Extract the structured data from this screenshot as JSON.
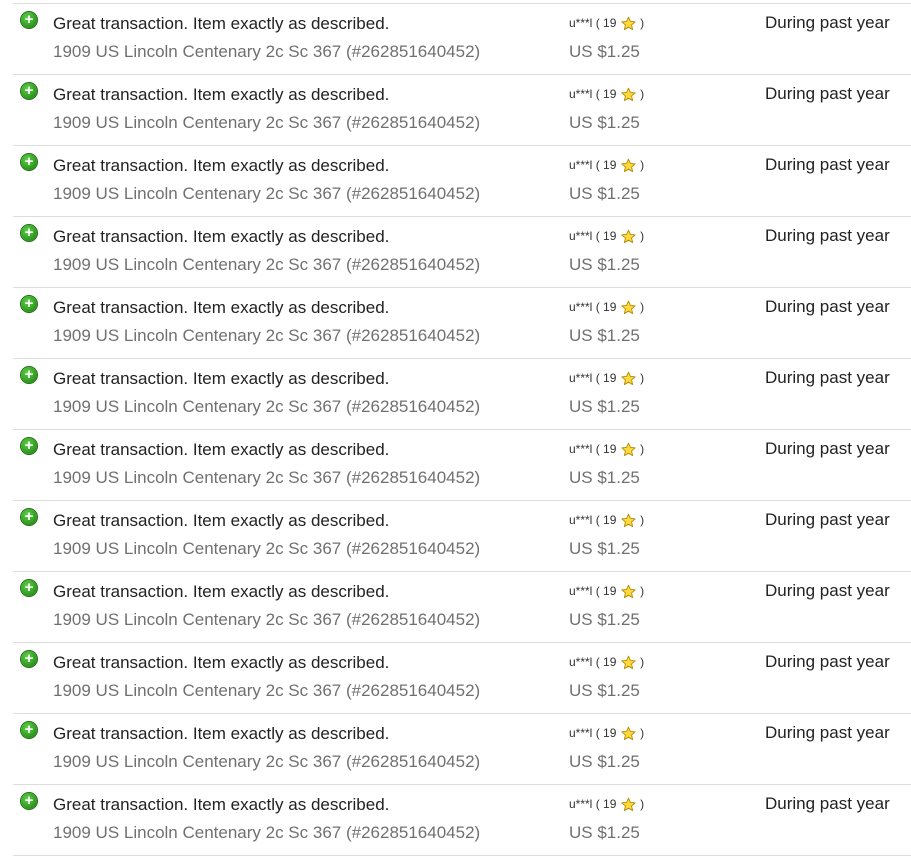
{
  "feedback": [
    {
      "comment": "Great transaction. Item exactly as described.",
      "item": "1909 US Lincoln Centenary 2c Sc 367 (#262851640452)",
      "user": "u***l",
      "score": "19",
      "price": "US $1.25",
      "period": "During past year",
      "icon": "plus-circle-icon",
      "star_icon": "star-icon"
    },
    {
      "comment": "Great transaction. Item exactly as described.",
      "item": "1909 US Lincoln Centenary 2c Sc 367 (#262851640452)",
      "user": "u***l",
      "score": "19",
      "price": "US $1.25",
      "period": "During past year",
      "icon": "plus-circle-icon",
      "star_icon": "star-icon"
    },
    {
      "comment": "Great transaction. Item exactly as described.",
      "item": "1909 US Lincoln Centenary 2c Sc 367 (#262851640452)",
      "user": "u***l",
      "score": "19",
      "price": "US $1.25",
      "period": "During past year",
      "icon": "plus-circle-icon",
      "star_icon": "star-icon"
    },
    {
      "comment": "Great transaction. Item exactly as described.",
      "item": "1909 US Lincoln Centenary 2c Sc 367 (#262851640452)",
      "user": "u***l",
      "score": "19",
      "price": "US $1.25",
      "period": "During past year",
      "icon": "plus-circle-icon",
      "star_icon": "star-icon"
    },
    {
      "comment": "Great transaction. Item exactly as described.",
      "item": "1909 US Lincoln Centenary 2c Sc 367 (#262851640452)",
      "user": "u***l",
      "score": "19",
      "price": "US $1.25",
      "period": "During past year",
      "icon": "plus-circle-icon",
      "star_icon": "star-icon"
    },
    {
      "comment": "Great transaction. Item exactly as described.",
      "item": "1909 US Lincoln Centenary 2c Sc 367 (#262851640452)",
      "user": "u***l",
      "score": "19",
      "price": "US $1.25",
      "period": "During past year",
      "icon": "plus-circle-icon",
      "star_icon": "star-icon"
    },
    {
      "comment": "Great transaction. Item exactly as described.",
      "item": "1909 US Lincoln Centenary 2c Sc 367 (#262851640452)",
      "user": "u***l",
      "score": "19",
      "price": "US $1.25",
      "period": "During past year",
      "icon": "plus-circle-icon",
      "star_icon": "star-icon"
    },
    {
      "comment": "Great transaction. Item exactly as described.",
      "item": "1909 US Lincoln Centenary 2c Sc 367 (#262851640452)",
      "user": "u***l",
      "score": "19",
      "price": "US $1.25",
      "period": "During past year",
      "icon": "plus-circle-icon",
      "star_icon": "star-icon"
    },
    {
      "comment": "Great transaction. Item exactly as described.",
      "item": "1909 US Lincoln Centenary 2c Sc 367 (#262851640452)",
      "user": "u***l",
      "score": "19",
      "price": "US $1.25",
      "period": "During past year",
      "icon": "plus-circle-icon",
      "star_icon": "star-icon"
    },
    {
      "comment": "Great transaction. Item exactly as described.",
      "item": "1909 US Lincoln Centenary 2c Sc 367 (#262851640452)",
      "user": "u***l",
      "score": "19",
      "price": "US $1.25",
      "period": "During past year",
      "icon": "plus-circle-icon",
      "star_icon": "star-icon"
    },
    {
      "comment": "Great transaction. Item exactly as described.",
      "item": "1909 US Lincoln Centenary 2c Sc 367 (#262851640452)",
      "user": "u***l",
      "score": "19",
      "price": "US $1.25",
      "period": "During past year",
      "icon": "plus-circle-icon",
      "star_icon": "star-icon"
    },
    {
      "comment": "Great transaction. Item exactly as described.",
      "item": "1909 US Lincoln Centenary 2c Sc 367 (#262851640452)",
      "user": "u***l",
      "score": "19",
      "price": "US $1.25",
      "period": "During past year",
      "icon": "plus-circle-icon",
      "star_icon": "star-icon"
    }
  ],
  "colors": {
    "positive_icon": "#2f9a1e",
    "star_fill": "#ffd93d",
    "star_stroke": "#b08a00",
    "primary_text": "#222222",
    "secondary_text": "#707070",
    "divider": "#dddddd"
  }
}
